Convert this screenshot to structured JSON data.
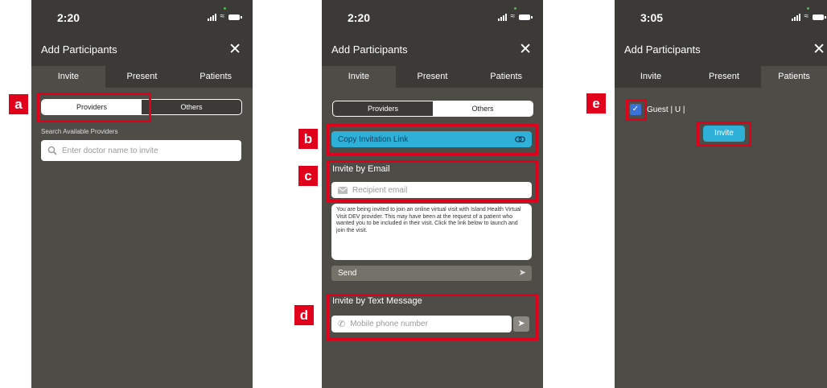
{
  "phones": [
    {
      "time": "2:20",
      "title": "Add Participants",
      "tabs": [
        "Invite",
        "Present",
        "Patients"
      ],
      "segment": [
        "Providers",
        "Others"
      ],
      "search_label": "Search Available Providers",
      "search_placeholder": "Enter doctor name to invite"
    },
    {
      "time": "2:20",
      "title": "Add Participants",
      "tabs": [
        "Invite",
        "Present",
        "Patients"
      ],
      "segment": [
        "Providers",
        "Others"
      ],
      "copy_link_label": "Copy Invitation Link",
      "email_heading": "Invite by Email",
      "email_placeholder": "Recipient email",
      "message_text": "You are being invited to join an online virtual visit with Island Health Virtual Visit DEV provider. This may have been at the request of a patient who wanted you to be included in their visit. Click the link below to launch and join the visit.",
      "send_label": "Send",
      "sms_heading": "Invite by Text Message",
      "phone_placeholder": "Mobile phone number"
    },
    {
      "time": "3:05",
      "title": "Add Participants",
      "tabs": [
        "Invite",
        "Present",
        "Patients"
      ],
      "guest_label": "Guest  | U |",
      "invite_button": "Invite"
    }
  ],
  "annotations": [
    "a",
    "b",
    "c",
    "d",
    "e"
  ],
  "colors": {
    "panel": "#4e4c47",
    "header": "#3b3a36",
    "accent": "#2fb0d8",
    "highlight": "#e0001b"
  },
  "icons": [
    "close-icon",
    "search-icon",
    "link-icon",
    "mail-icon",
    "phone-icon",
    "send-arrow-icon",
    "checkbox-checked-icon",
    "signal-icon",
    "wifi-icon",
    "battery-icon"
  ]
}
